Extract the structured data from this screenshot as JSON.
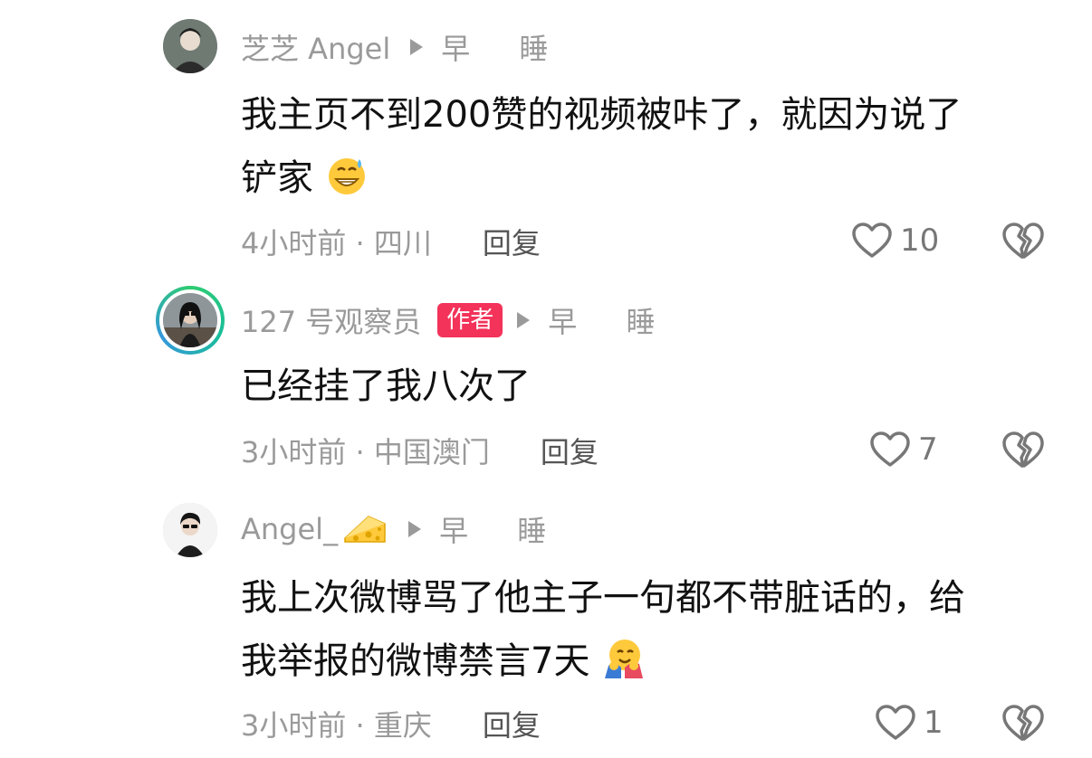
{
  "comments": [
    {
      "username": "芝芝 Angel",
      "reply_target": "早 睡",
      "text": "我主页不到200赞的视频被咔了，就因为说了铲家",
      "text_line1": "我主页不到200赞的视频被咔了，就因为说了",
      "text_line2": "铲家",
      "emoji_icon": "grinning-sweat-emoji",
      "time": "4小时前",
      "location": "四川",
      "meta": "4小时前 · 四川",
      "reply_label": "回复",
      "likes": "10",
      "author": false
    },
    {
      "username": "127 号观察员",
      "badge": "作者",
      "reply_target": "早 睡",
      "text": "已经挂了我八次了",
      "time": "3小时前",
      "location": "中国澳门",
      "meta": "3小时前 · 中国澳门",
      "reply_label": "回复",
      "likes": "7",
      "author": true
    },
    {
      "username": "Angel_",
      "username_emoji": "cheese-emoji",
      "reply_target": "早 睡",
      "text": "我上次微博骂了他主子一句都不带脏话的，给我举报的微博禁言7天",
      "text_line1": "我上次微博骂了他主子一句都不带脏话的，给",
      "text_line2": "我举报的微博禁言7天",
      "emoji_icon": "hugging-face-emoji",
      "time": "3小时前",
      "location": "重庆",
      "meta": "3小时前 · 重庆",
      "reply_label": "回复",
      "likes": "1",
      "author": false
    }
  ],
  "colors": {
    "text": "#111111",
    "muted": "#9a9a9a",
    "badge": "#f3335a"
  }
}
